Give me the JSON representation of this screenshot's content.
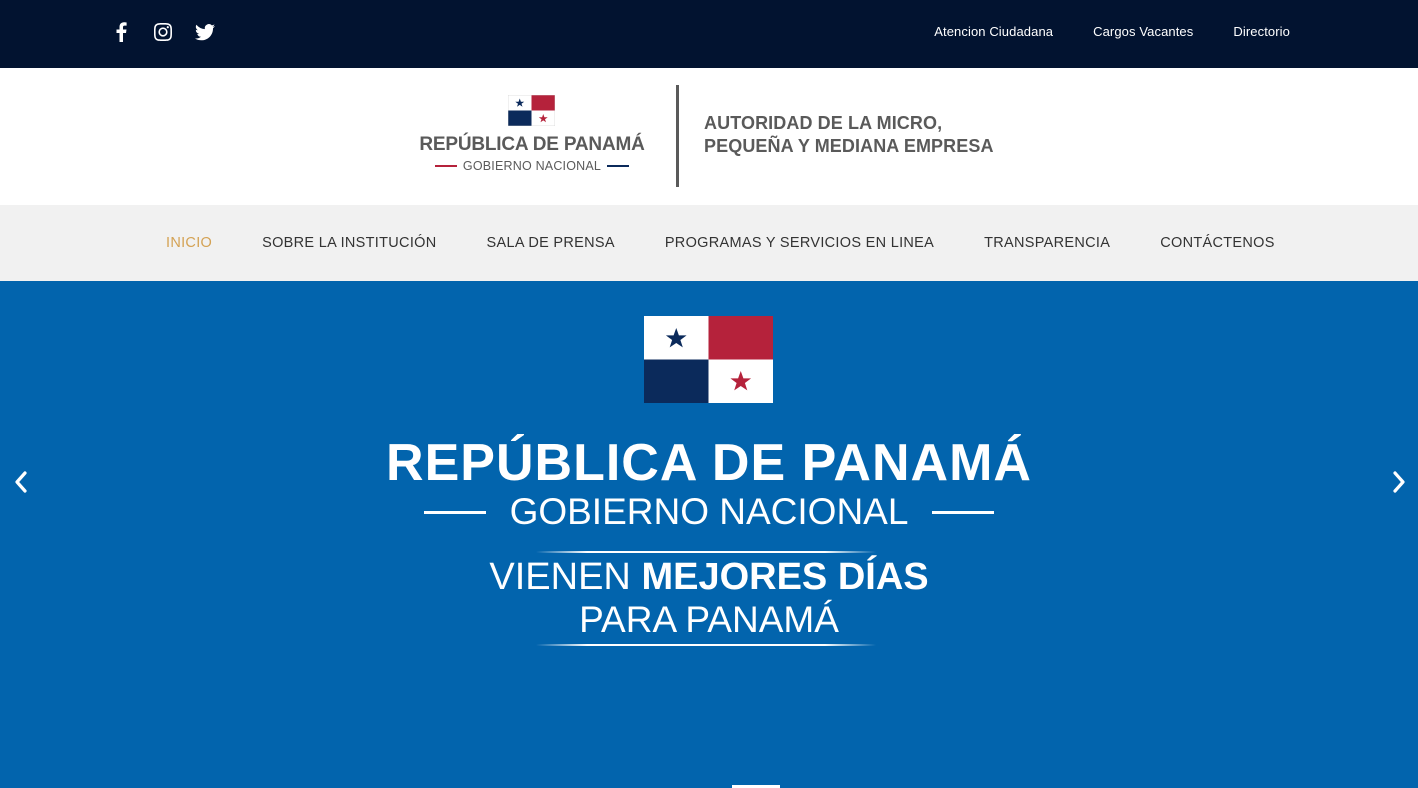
{
  "topbar": {
    "social": [
      {
        "icon": "facebook-icon"
      },
      {
        "icon": "instagram-icon"
      },
      {
        "icon": "twitter-icon"
      }
    ],
    "links": [
      "Atencion Ciudadana",
      "Cargos Vacantes",
      "Directorio"
    ]
  },
  "header": {
    "logo_title": "REPÚBLICA DE PANAMÁ",
    "logo_subtitle": "GOBIERNO NACIONAL",
    "institution_line1": "AUTORIDAD DE LA MICRO,",
    "institution_line2": "PEQUEÑA Y MEDIANA EMPRESA"
  },
  "nav": {
    "items": [
      {
        "label": "INICIO",
        "active": true
      },
      {
        "label": "SOBRE LA INSTITUCIÓN",
        "active": false
      },
      {
        "label": "SALA DE PRENSA",
        "active": false
      },
      {
        "label": "PROGRAMAS Y SERVICIOS EN LINEA",
        "active": false
      },
      {
        "label": "TRANSPARENCIA",
        "active": false
      },
      {
        "label": "CONTÁCTENOS",
        "active": false
      }
    ]
  },
  "hero": {
    "title": "REPÚBLICA DE PANAMÁ",
    "subtitle": "GOBIERNO NACIONAL",
    "slogan_light": "VIENEN ",
    "slogan_bold": "MEJORES DÍAS",
    "slogan_line2": "PARA PANAMÁ",
    "prev_icon": "chevron-left-icon",
    "next_icon": "chevron-right-icon"
  },
  "colors": {
    "topbar_bg": "#021330",
    "nav_bg": "#f1f1f1",
    "nav_active": "#d4a254",
    "hero_bg": "#0264ad",
    "flag_red": "#b5223b",
    "flag_blue": "#0b2a5b"
  }
}
